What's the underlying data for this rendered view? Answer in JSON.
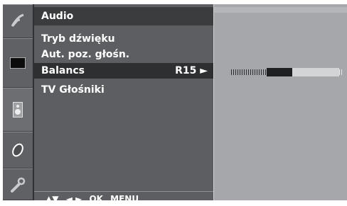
{
  "menu": {
    "title": "Audio",
    "items": [
      {
        "label": "Tryb dźwięku",
        "value": ""
      },
      {
        "label": "Aut. poz. głośn.",
        "value": ""
      },
      {
        "label": "Balancs",
        "value": "R15 ►"
      },
      {
        "label": "TV Głośniki",
        "value": ""
      }
    ],
    "selected_index": 2
  },
  "nav_hints": [
    "▲▼",
    "◄ ►",
    "OK",
    "MENU"
  ],
  "balance": {
    "value": "R15"
  },
  "colors": {
    "panel": "#5c5e61",
    "title_bar": "#3a3c3e",
    "selected_row": "#2d2f31",
    "right_panel": "#a5a7aa",
    "slider_thumb": "#1f2022",
    "slider_track": "#d2d4d6"
  },
  "icons": [
    "satellite-dish-icon",
    "tv-picture-icon",
    "speaker-icon",
    "clock-icon",
    "wrench-icon"
  ]
}
